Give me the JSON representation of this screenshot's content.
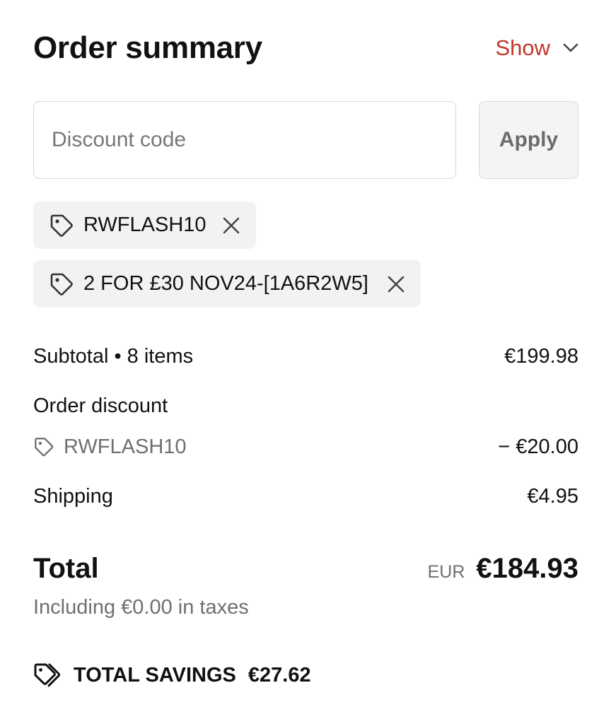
{
  "header": {
    "title": "Order summary",
    "toggle_label": "Show"
  },
  "discount": {
    "placeholder": "Discount code",
    "value": "",
    "apply_label": "Apply",
    "applied_codes": [
      {
        "code": "RWFLASH10"
      },
      {
        "code": "2 FOR £30 NOV24-[1A6R2W5]"
      }
    ]
  },
  "summary": {
    "subtotal_label": "Subtotal • 8 items",
    "subtotal_value": "€199.98",
    "order_discount_label": "Order discount",
    "order_discount_code": "RWFLASH10",
    "order_discount_value": "− €20.00",
    "shipping_label": "Shipping",
    "shipping_value": "€4.95",
    "total_label": "Total",
    "currency": "EUR",
    "total_value": "€184.93",
    "taxes_note": "Including €0.00 in taxes",
    "savings_label": "TOTAL SAVINGS",
    "savings_value": "€27.62"
  },
  "colors": {
    "accent": "#c0392b",
    "muted_text": "#6f6f6f",
    "tag_background": "#f2f2f2"
  },
  "icons": {
    "toggle": "chevron-down-icon",
    "tag": "tag-icon",
    "remove": "close-icon",
    "savings": "double-tag-icon"
  }
}
